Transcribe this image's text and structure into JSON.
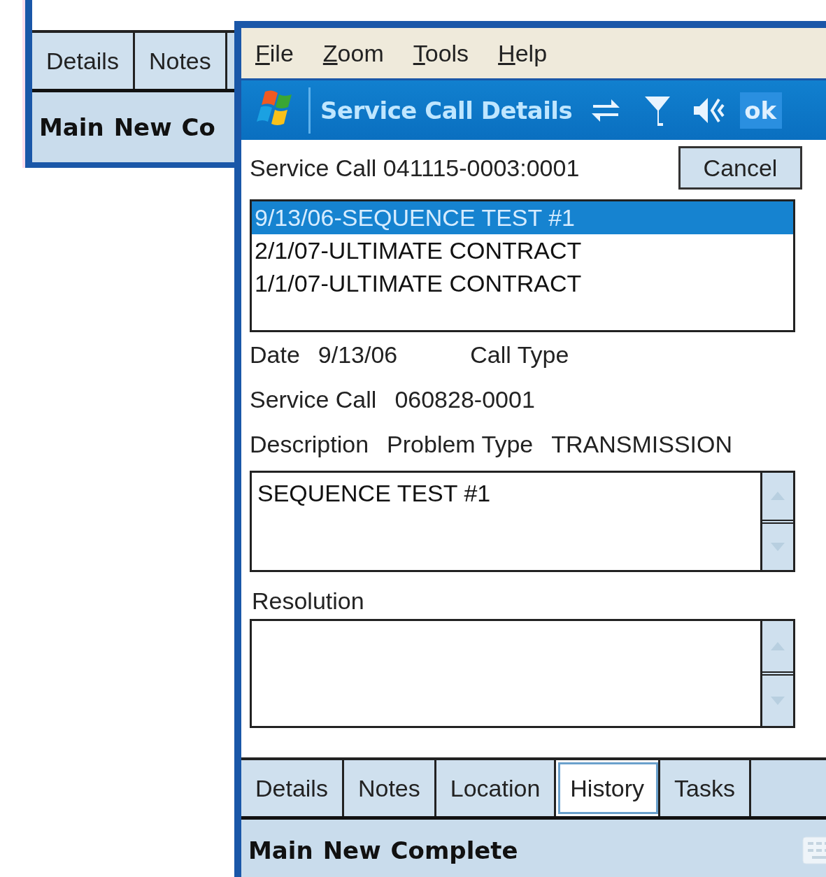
{
  "back_window": {
    "tabs": [
      {
        "label": "Details",
        "selected": false
      },
      {
        "label": "Notes",
        "selected": false
      }
    ],
    "softkeys": [
      "Main",
      "New",
      "Co"
    ]
  },
  "window": {
    "menu": [
      "File",
      "Zoom",
      "Tools",
      "Help"
    ],
    "title": "Service Call Details",
    "status_icons": [
      {
        "kind": "sync"
      },
      {
        "kind": "signal"
      },
      {
        "kind": "volume"
      }
    ],
    "ok": "ok"
  },
  "header": {
    "label": "Service Call 041115-0003:0001",
    "cancel": "Cancel"
  },
  "history": [
    {
      "label": "9/13/06-SEQUENCE TEST #1",
      "selected": true
    },
    {
      "label": "2/1/07-ULTIMATE CONTRACT",
      "selected": false
    },
    {
      "label": "1/1/07-ULTIMATE CONTRACT",
      "selected": false
    }
  ],
  "fields": [
    {
      "label": "Date",
      "value": "9/13/06",
      "label_2": "Call Type"
    },
    {
      "label": "Service Call",
      "value": "060828-0001"
    },
    {
      "label": "Description",
      "label_2": "Problem Type",
      "value_2": "TRANSMISSION"
    }
  ],
  "description": {
    "value": "SEQUENCE TEST #1"
  },
  "resolution": {
    "label": "Resolution"
  },
  "tabs": [
    {
      "label": "Details",
      "selected": false
    },
    {
      "label": "Notes",
      "selected": false
    },
    {
      "label": "Location",
      "selected": false
    },
    {
      "label": "History",
      "selected": true
    },
    {
      "label": "Tasks",
      "selected": false
    }
  ],
  "softkeys": [
    "Main",
    "New",
    "Complete"
  ]
}
